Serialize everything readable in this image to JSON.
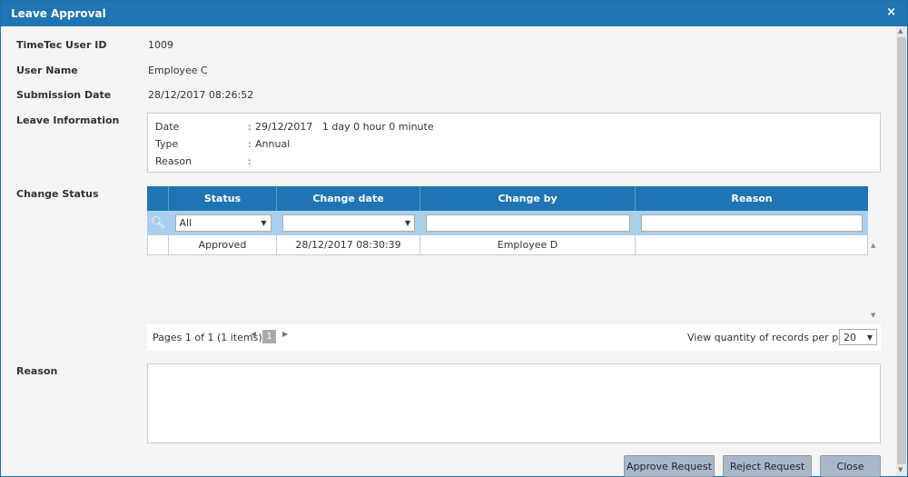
{
  "dialog": {
    "title": "Leave Approval",
    "close_glyph": "×"
  },
  "fields": {
    "user_id_label": "TimeTec User ID",
    "user_id": "1009",
    "user_name_label": "User Name",
    "user_name": "Employee C",
    "submission_label": "Submission Date",
    "submission": "28/12/2017 08:26:52",
    "leave_info_label": "Leave Information",
    "change_status_label": "Change Status",
    "reason_label": "Reason"
  },
  "leave_info": {
    "date_key": "Date",
    "date_val": "29/12/2017   1 day 0 hour 0 minute",
    "type_key": "Type",
    "type_val": "Annual",
    "reason_key": "Reason",
    "reason_val": "",
    "colon": ":"
  },
  "grid": {
    "headers": {
      "status": "Status",
      "change_date": "Change date",
      "change_by": "Change by",
      "reason": "Reason"
    },
    "filter_status": "All",
    "rows": [
      {
        "status": "Approved",
        "change_date": "28/12/2017 08:30:39",
        "change_by": "Employee D",
        "reason": ""
      }
    ]
  },
  "pager": {
    "summary": "Pages 1 of 1 (1 items)",
    "current_page": "1",
    "qty_label": "View quantity of records per page",
    "qty_value": "20"
  },
  "buttons": {
    "approve": "Approve Request",
    "reject": "Reject Request",
    "close": "Close"
  },
  "colors": {
    "primary": "#1f75b4",
    "filter_bg": "#a8d0ee",
    "button_bg": "#a8b8c6"
  },
  "icons": {
    "search": "search-icon",
    "close": "close-icon",
    "caret": "chevron-down-icon"
  }
}
